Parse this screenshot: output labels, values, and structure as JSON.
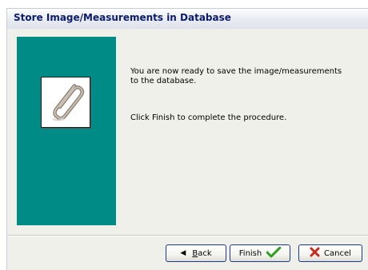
{
  "window": {
    "title": "Store Image/Measurements in Database"
  },
  "content": {
    "message_line1": "You are now ready to save the image/measurements",
    "message_line2": "to the database.",
    "instruction": "Click Finish to complete the procedure."
  },
  "panel": {
    "color": "#008b87",
    "icon": "paperclip-icon"
  },
  "buttons": {
    "back_accel": "B",
    "back_rest": "ack",
    "finish_label": "Finish",
    "cancel_label": "Cancel"
  },
  "colors": {
    "title_text": "#0b1c6e",
    "check_green": "#2e9e1f",
    "cancel_red": "#1c3a8f"
  }
}
